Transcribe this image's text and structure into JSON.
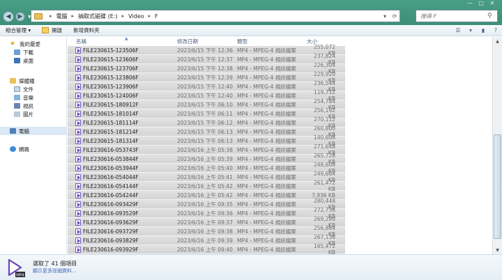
{
  "address": {
    "crumbs": [
      "電腦",
      "抽取式磁碟 (E:)",
      "Video",
      "F"
    ]
  },
  "search": {
    "placeholder": "搜尋 F"
  },
  "toolbar": {
    "organize": "組合管理 ▾",
    "open": "開啟",
    "new_folder": "新增資料夾"
  },
  "sidebar": {
    "favorites": "我的最愛",
    "downloads": "下載",
    "desktop": "桌面",
    "libraries": "媒體櫃",
    "documents": "文件",
    "music": "音樂",
    "videos": "視訊",
    "pictures": "圖片",
    "computer": "電腦",
    "network": "網路"
  },
  "columns": {
    "name": "名稱",
    "date": "修改日期",
    "type": "類型",
    "size": "大小"
  },
  "files": [
    {
      "name": "FILE230615-123506F",
      "date": "2023/6/15 下午 12:36",
      "type": "MP4 - MPEG-4 視訊檔案",
      "size": "255,072 KB"
    },
    {
      "name": "FILE230615-123606F",
      "date": "2023/6/15 下午 12:37",
      "type": "MP4 - MPEG-4 視訊檔案",
      "size": "237,824 KB"
    },
    {
      "name": "FILE230615-123706F",
      "date": "2023/6/15 下午 12:38",
      "type": "MP4 - MPEG-4 視訊檔案",
      "size": "226,304 KB"
    },
    {
      "name": "FILE230615-123806F",
      "date": "2023/6/15 下午 12:39",
      "type": "MP4 - MPEG-4 視訊檔案",
      "size": "229,920 KB"
    },
    {
      "name": "FILE230615-123906F",
      "date": "2023/6/15 下午 12:40",
      "type": "MP4 - MPEG-4 視訊檔案",
      "size": "236,544 KB"
    },
    {
      "name": "FILE230615-124006F",
      "date": "2023/6/15 下午 12:40",
      "type": "MP4 - MPEG-4 視訊檔案",
      "size": "119,712 KB"
    },
    {
      "name": "FILE230615-180912F",
      "date": "2023/6/15 下午 06:10",
      "type": "MP4 - MPEG-4 視訊檔案",
      "size": "254,784 KB"
    },
    {
      "name": "FILE230615-181014F",
      "date": "2023/6/15 下午 06:11",
      "type": "MP4 - MPEG-4 視訊檔案",
      "size": "256,192 KB"
    },
    {
      "name": "FILE230615-181114F",
      "date": "2023/6/15 下午 06:12",
      "type": "MP4 - MPEG-4 視訊檔案",
      "size": "270,112 KB"
    },
    {
      "name": "FILE230615-181214F",
      "date": "2023/6/15 下午 06:13",
      "type": "MP4 - MPEG-4 視訊檔案",
      "size": "260,800 KB"
    },
    {
      "name": "FILE230615-181314F",
      "date": "2023/6/15 下午 06:13",
      "type": "MP4 - MPEG-4 視訊檔案",
      "size": "140,608 KB"
    },
    {
      "name": "FILE230616-053743F",
      "date": "2023/6/16 上午 05:38",
      "type": "MP4 - MPEG-4 視訊檔案",
      "size": "271,648 KB"
    },
    {
      "name": "FILE230616-053844F",
      "date": "2023/6/16 上午 05:39",
      "type": "MP4 - MPEG-4 視訊檔案",
      "size": "265,728 KB"
    },
    {
      "name": "FILE230616-053944F",
      "date": "2023/6/16 上午 05:40",
      "type": "MP4 - MPEG-4 視訊檔案",
      "size": "248,608 KB"
    },
    {
      "name": "FILE230616-054044F",
      "date": "2023/6/16 上午 05:41",
      "type": "MP4 - MPEG-4 視訊檔案",
      "size": "249,664 KB"
    },
    {
      "name": "FILE230616-054144F",
      "date": "2023/6/16 上午 05:42",
      "type": "MP4 - MPEG-4 視訊檔案",
      "size": "261,472 KB"
    },
    {
      "name": "FILE230616-054244F",
      "date": "2023/6/16 上午 05:42",
      "type": "MP4 - MPEG-4 視訊檔案",
      "size": "7,936 KB"
    },
    {
      "name": "FILE230616-093429F",
      "date": "2023/6/16 上午 09:35",
      "type": "MP4 - MPEG-4 視訊檔案",
      "size": "280,448 KB"
    },
    {
      "name": "FILE230616-093529F",
      "date": "2023/6/16 上午 09:36",
      "type": "MP4 - MPEG-4 視訊檔案",
      "size": "272,736 KB"
    },
    {
      "name": "FILE230616-093629F",
      "date": "2023/6/16 上午 09:37",
      "type": "MP4 - MPEG-4 視訊檔案",
      "size": "269,280 KB"
    },
    {
      "name": "FILE230616-093729F",
      "date": "2023/6/16 上午 09:38",
      "type": "MP4 - MPEG-4 視訊檔案",
      "size": "256,864 KB"
    },
    {
      "name": "FILE230616-093829F",
      "date": "2023/6/16 上午 09:39",
      "type": "MP4 - MPEG-4 視訊檔案",
      "size": "267,136 KB"
    },
    {
      "name": "FILE230616-093929F",
      "date": "2023/6/16 上午 09:40",
      "type": "MP4 - MPEG-4 視訊檔案",
      "size": "165,472 KB"
    }
  ],
  "details": {
    "selected": "選取了 41 個項目",
    "more": "顯示更多詳細資料...",
    "icon_label": "MP4"
  },
  "colors": {
    "titlebar": "#3d8f77",
    "selected_row": "#d9d9d9",
    "link": "#3b6ab3"
  }
}
